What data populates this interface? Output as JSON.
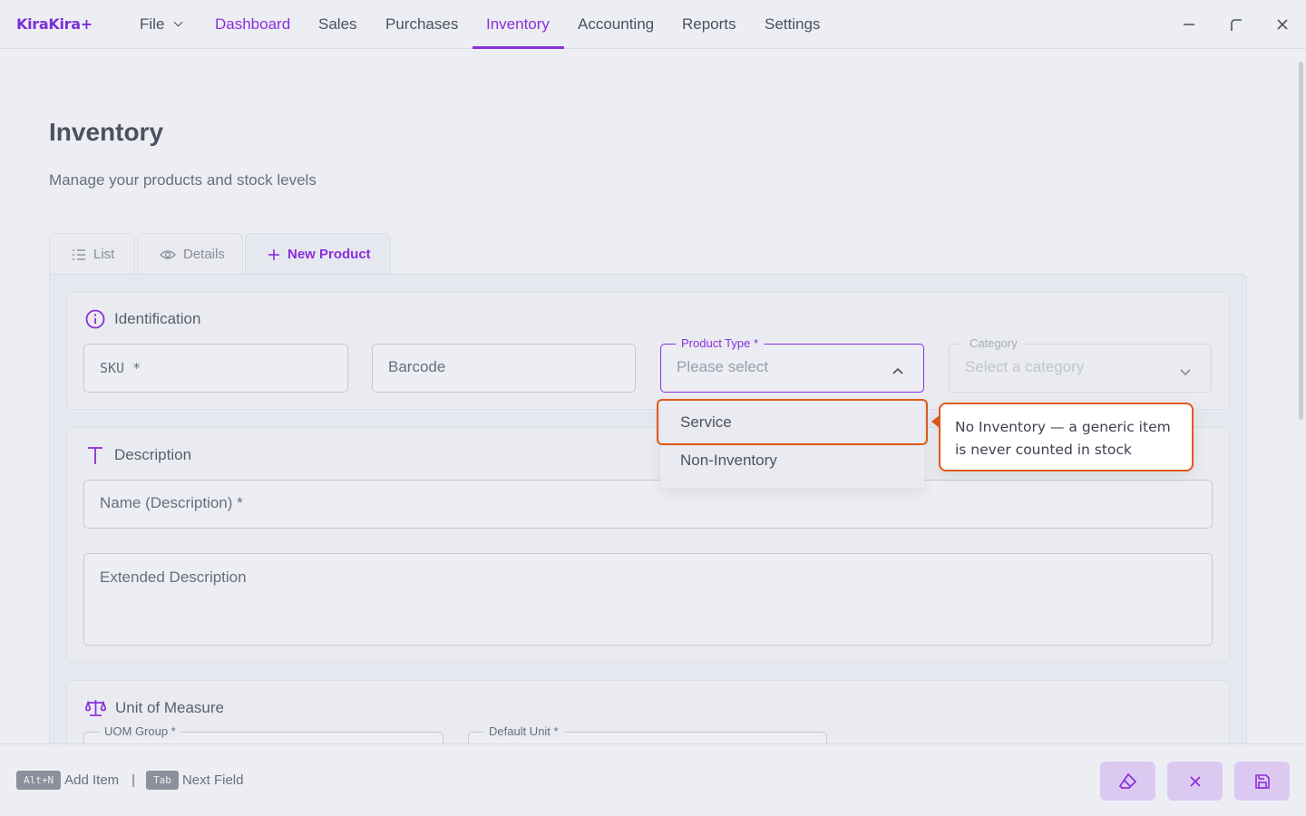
{
  "app": {
    "logo": "KiraKira+"
  },
  "menu": {
    "file": "File",
    "dashboard": "Dashboard",
    "sales": "Sales",
    "purchases": "Purchases",
    "inventory": "Inventory",
    "accounting": "Accounting",
    "reports": "Reports",
    "settings": "Settings",
    "active": "Inventory"
  },
  "page": {
    "title": "Inventory",
    "subtitle": "Manage your products and stock levels"
  },
  "tabs": [
    {
      "label": "List",
      "icon": "list-icon"
    },
    {
      "label": "Details",
      "icon": "eye-icon"
    },
    {
      "label": "New Product",
      "icon": "plus-icon",
      "active": true
    }
  ],
  "identification": {
    "title": "Identification",
    "sku_label": "SKU *",
    "barcode_placeholder": "Barcode",
    "product_type_label": "Product Type *",
    "product_type_placeholder": "Please select",
    "category_label": "Category",
    "category_placeholder": "Select a category"
  },
  "product_type_options": [
    "Service",
    "Non-Inventory"
  ],
  "tooltip": {
    "text": "No Inventory — a generic item is never counted in stock"
  },
  "description": {
    "title": "Description",
    "name_label": "Name (Description) *",
    "extended_label": "Extended Description"
  },
  "uom": {
    "title": "Unit of Measure",
    "group_label": "UOM Group *",
    "default_label": "Default Unit *"
  },
  "footer": {
    "hint1_key": "Alt+N",
    "hint1_text": "Add Item",
    "separator": "|",
    "hint2_key": "Tab",
    "hint2_text": "Next Field"
  },
  "colors": {
    "accent": "#8a2fd8",
    "highlight": "#e05a17",
    "button_bg": "#dcc9f2"
  }
}
